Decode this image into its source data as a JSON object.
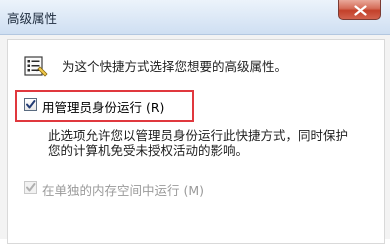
{
  "window": {
    "title": "高级属性"
  },
  "header": {
    "text": "为这个快捷方式选择您想要的高级属性。",
    "icon": "shortcut-properties-icon"
  },
  "options": {
    "run_as_admin": {
      "label": "用管理员身份运行 (R)",
      "checked": true,
      "enabled": true
    },
    "description_lines": [
      "此选项允许您以管理员身份运行此快捷方式，同时保护",
      "您的计算机免受未授权活动的影响。"
    ],
    "separate_memory": {
      "label": "在单独的内存空间中运行 (M)",
      "checked": true,
      "enabled": false
    }
  },
  "colors": {
    "highlight_border": "#e0383e",
    "close_button": "#c3402a",
    "disabled_text": "#9a9a9a"
  }
}
